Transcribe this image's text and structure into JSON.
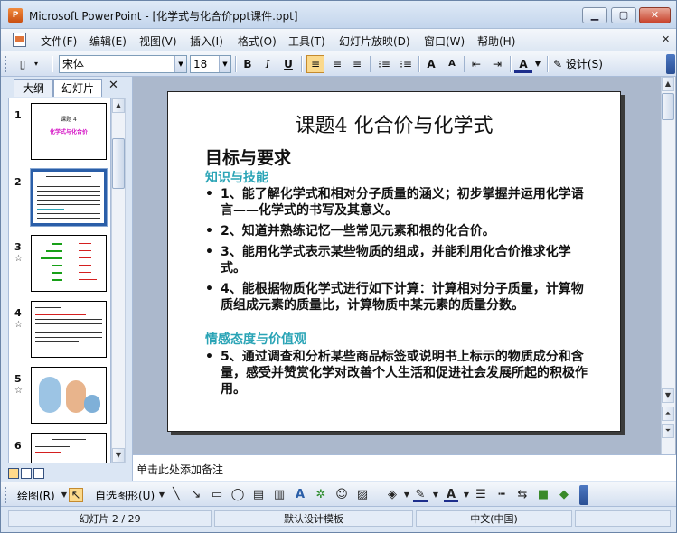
{
  "window": {
    "title": "Microsoft PowerPoint - [化学式与化合价ppt课件.ppt]",
    "app_icon": "powerpoint-icon",
    "controls": [
      "minimize",
      "maximize",
      "close"
    ]
  },
  "menu": {
    "items": [
      "文件(F)",
      "编辑(E)",
      "视图(V)",
      "插入(I)",
      "格式(O)",
      "工具(T)",
      "幻灯片放映(D)",
      "窗口(W)",
      "帮助(H)"
    ],
    "close_doc": "✕"
  },
  "toolbar": {
    "font_name": "宋体",
    "font_size": "18",
    "bold": "B",
    "italic": "I",
    "underline": "U",
    "design_label": "设计(S)",
    "grow_font": "A",
    "shrink_font": "A",
    "font_color": "A"
  },
  "pane": {
    "tabs": [
      "大纲",
      "幻灯片"
    ],
    "close": "✕",
    "thumbnails": [
      {
        "num": "1",
        "title": "课题 4",
        "subtitle": "化学式与化合价"
      },
      {
        "num": "2"
      },
      {
        "num": "3"
      },
      {
        "num": "4"
      },
      {
        "num": "5"
      },
      {
        "num": "6"
      }
    ]
  },
  "slide": {
    "title": "课题4  化合价与化学式",
    "heading": "目标与要求",
    "section1": "知识与技能",
    "bullets1": [
      "1、能了解化学式和相对分子质量的涵义；初步掌握并运用化学语言——化学式的书写及其意义。",
      "2、知道并熟练记忆一些常见元素和根的化合价。",
      "3、能用化学式表示某些物质的组成，并能利用化合价推求化学式。",
      "4、能根据物质化学式进行如下计算：计算相对分子质量，计算物质组成元素的质量比，计算物质中某元素的质量分数。"
    ],
    "section2": "情感态度与价值观",
    "bullets2": [
      "5、通过调查和分析某些商品标签或说明书上标示的物质成分和含量，感受并赞赏化学对改善个人生活和促进社会发展所起的积极作用。"
    ],
    "bullet_char": "•"
  },
  "notes": {
    "placeholder": "单击此处添加备注"
  },
  "drawbar": {
    "draw_label": "绘图(R)",
    "autoshapes_label": "自选图形(U)"
  },
  "status": {
    "slide_pos": "幻灯片 2 / 29",
    "template": "默认设计模板",
    "language": "中文(中国)"
  },
  "colors": {
    "accent_section": "#2aa4b6",
    "selection": "#2a5ea8"
  }
}
